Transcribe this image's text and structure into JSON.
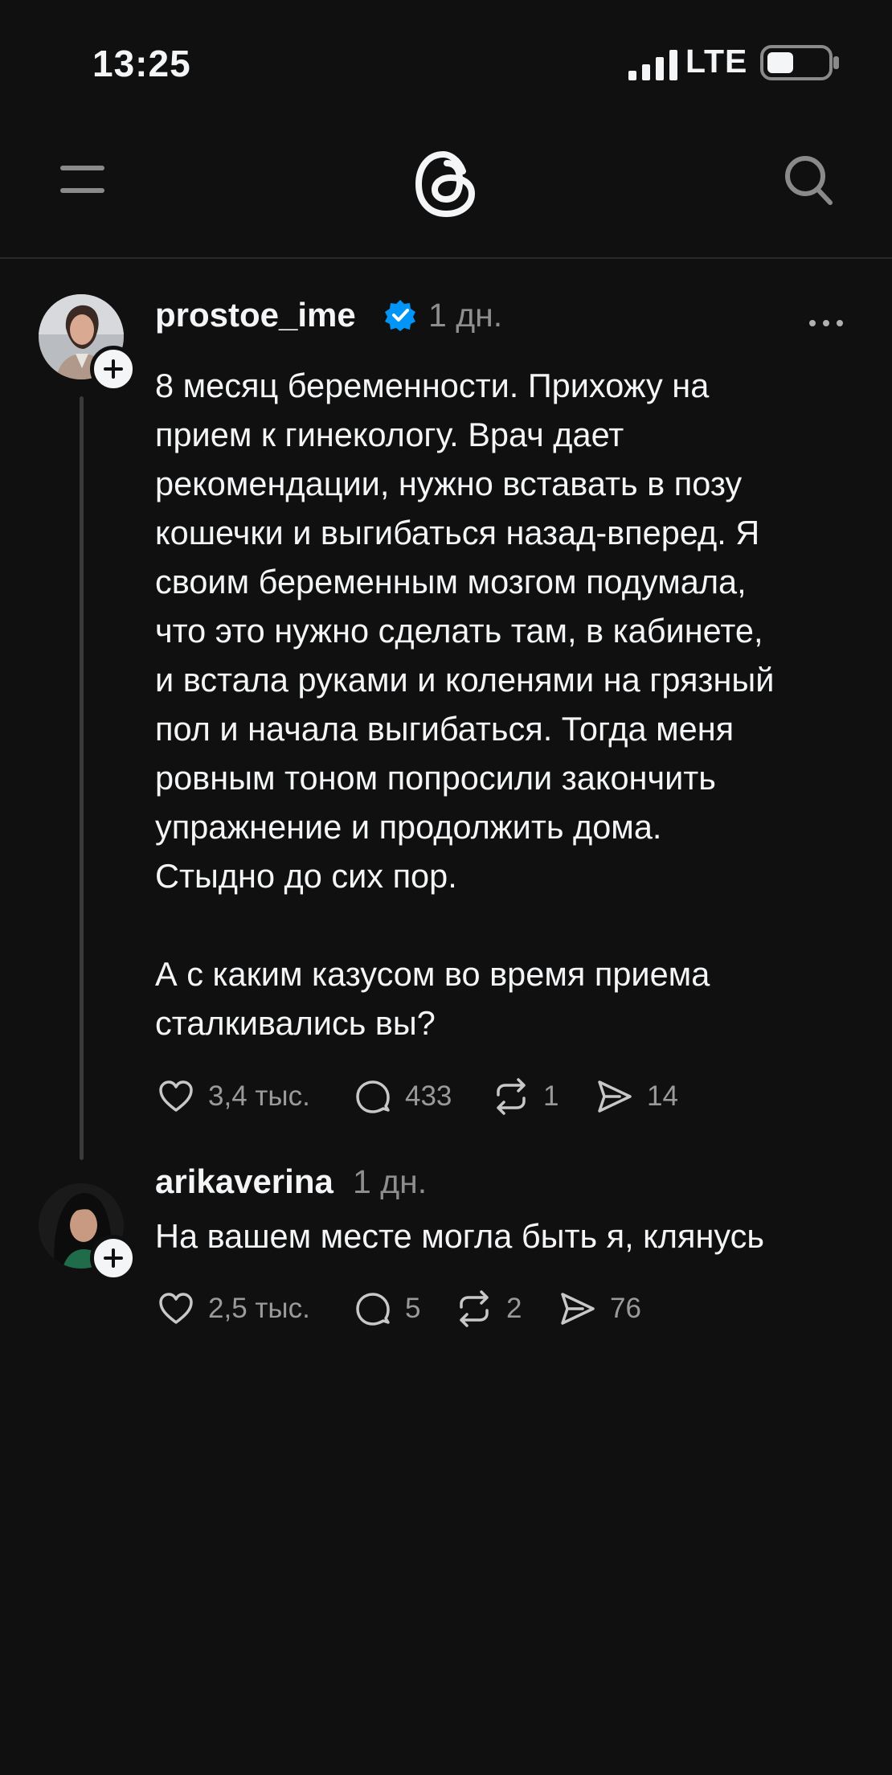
{
  "status_bar": {
    "time": "13:25",
    "network": "LTE",
    "battery_level": 0.45
  },
  "nav": {
    "menu_icon": "menu-icon",
    "logo_icon": "threads-logo-icon",
    "search_icon": "search-icon"
  },
  "post": {
    "username": "prostoe_ime",
    "verified": true,
    "time_ago": "1 дн.",
    "text": "8 месяц беременности. Прихожу на\nприем к гинекологу. Врач дает\nрекомендации, нужно вставать в позу\nкошечки и выгибаться назад-вперед. Я\nсвоим беременным мозгом подумала,\nчто это нужно сделать там, в кабинете,\nи встала руками и коленями на грязный\nпол и начала выгибаться. Тогда меня\nровным тоном попросили закончить\nупражнение и продолжить дома.\nСтыдно до сих пор.\n\nА с каким казусом во время приема\nсталкивались вы?",
    "likes": "3,4 тыс.",
    "comments": "433",
    "reposts": "1",
    "shares": "14"
  },
  "reply": {
    "username": "arikaverina",
    "time_ago": "1 дн.",
    "text": "На вашем месте могла быть я, клянусь",
    "likes": "2,5 тыс.",
    "comments": "5",
    "reposts": "2",
    "shares": "76"
  },
  "colors": {
    "background": "#101010",
    "text": "#f3f5f7",
    "muted": "#8e8e8e",
    "verified": "#0095f6"
  }
}
